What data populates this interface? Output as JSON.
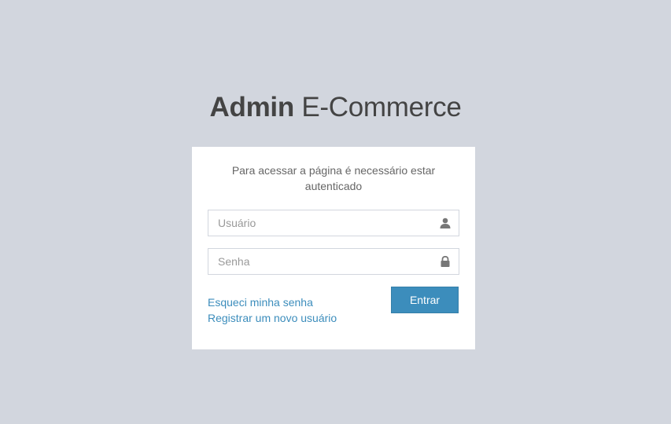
{
  "logo": {
    "bold": "Admin",
    "light": "E-Commerce"
  },
  "login": {
    "message": "Para acessar a página é necessário estar autenticado",
    "username_placeholder": "Usuário",
    "username_value": "",
    "username_icon": "user-icon",
    "password_placeholder": "Senha",
    "password_value": "",
    "password_icon": "lock-icon",
    "forgot_link": "Esqueci minha senha",
    "register_link": "Registrar um novo usuário",
    "submit_label": "Entrar"
  },
  "colors": {
    "background": "#d2d6de",
    "panel": "#ffffff",
    "primary": "#3c8dbc",
    "link": "#3c8dbc",
    "icon": "#777777"
  }
}
